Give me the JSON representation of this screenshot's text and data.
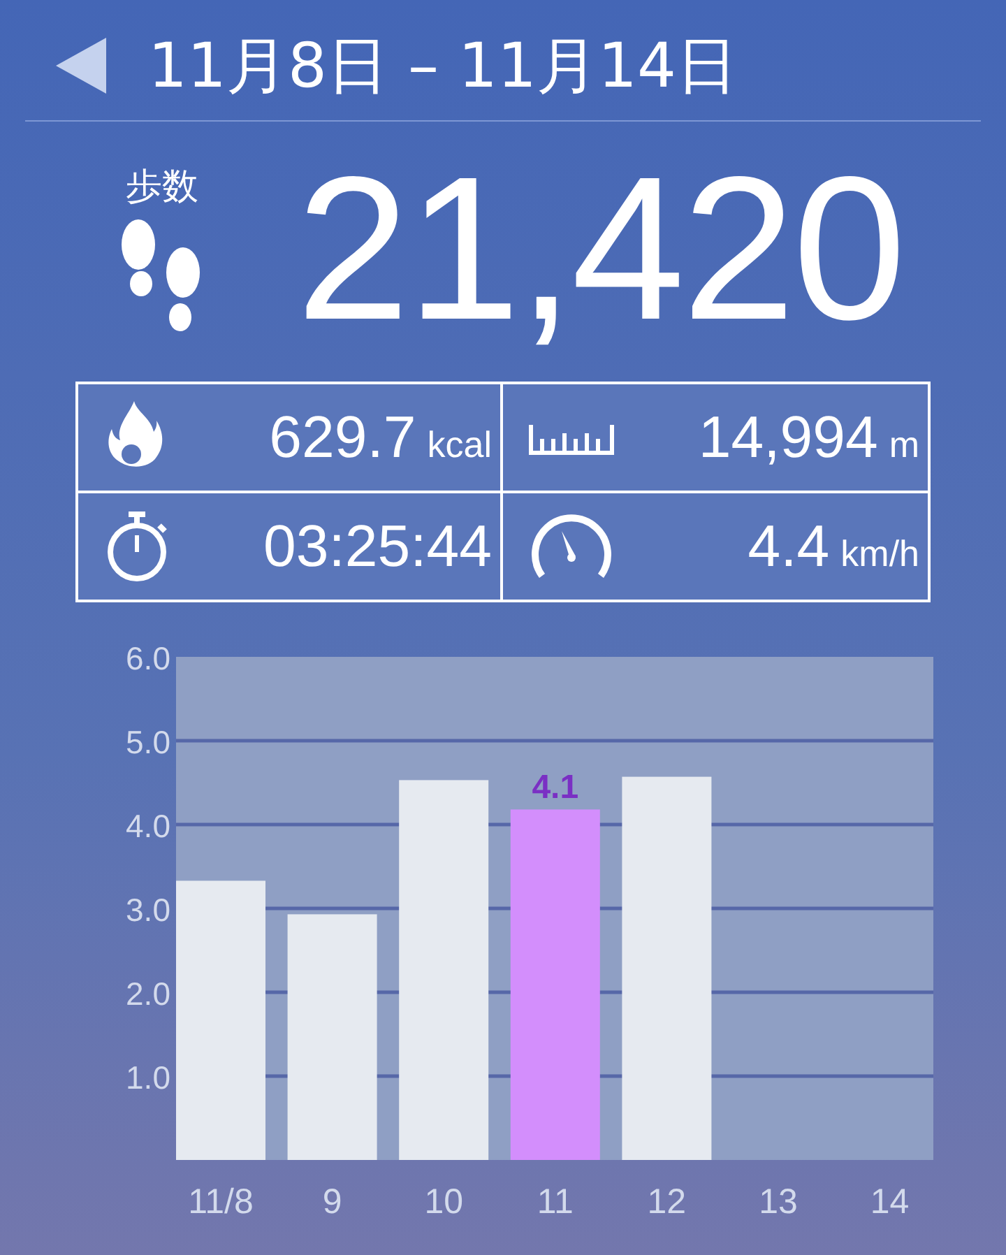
{
  "header": {
    "title": "11月8日 – 11月14日"
  },
  "steps": {
    "label": "歩数",
    "value": "21,420"
  },
  "stats": [
    {
      "kind": "calories",
      "value": "629.7",
      "unit": "kcal"
    },
    {
      "kind": "distance",
      "value": "14,994",
      "unit": "m"
    },
    {
      "kind": "time",
      "value": "03:25:44"
    },
    {
      "kind": "speed",
      "value": "4.4",
      "unit": "km/h"
    }
  ],
  "chart_data": {
    "type": "bar",
    "categories": [
      "11/8",
      "9",
      "10",
      "11",
      "12",
      "13",
      "14"
    ],
    "series": [
      {
        "color": "#e6eaf0",
        "values": [
          3.33,
          2.93,
          4.53,
          null,
          4.57,
          null,
          null
        ]
      },
      {
        "color": "#d38efc",
        "values": [
          null,
          null,
          null,
          4.18,
          null,
          null,
          null
        ]
      }
    ],
    "grid": true,
    "value_labels": [
      null,
      null,
      null,
      "4.1",
      null,
      null,
      null
    ],
    "ylim": [
      0,
      6
    ],
    "yticks": [
      {
        "value": 1,
        "label": "1.0"
      },
      {
        "value": 2,
        "label": "2.0"
      },
      {
        "value": 3,
        "label": "3.0"
      },
      {
        "value": 4,
        "label": "4.0"
      },
      {
        "value": 5,
        "label": "5.0"
      },
      {
        "value": 6,
        "label": "6.0"
      }
    ]
  }
}
